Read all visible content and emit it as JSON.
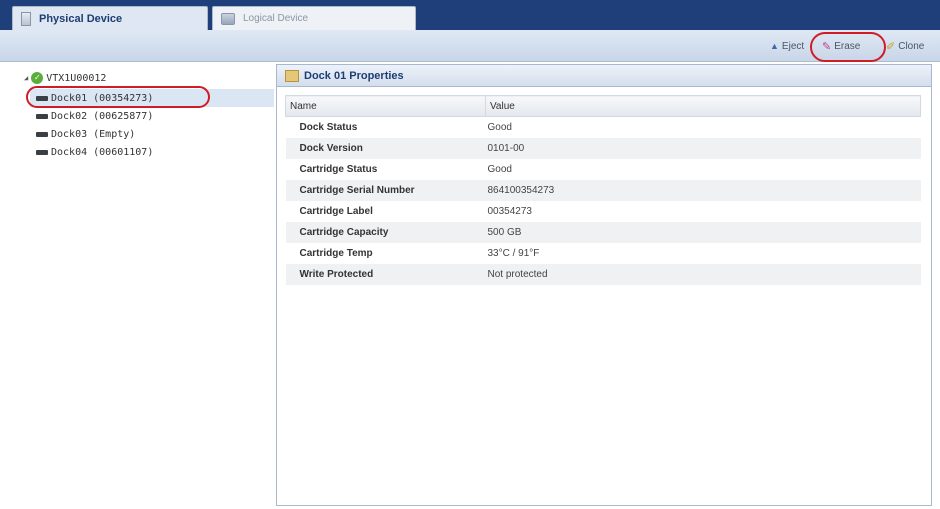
{
  "tabs": [
    {
      "label": "Physical Device",
      "active": true
    },
    {
      "label": "Logical Device",
      "active": false
    }
  ],
  "toolbar": {
    "eject_label": "Eject",
    "erase_label": "Erase",
    "clone_label": "Clone"
  },
  "tree": {
    "root_label": "VTX1U00012",
    "items": [
      {
        "label": "Dock01 (00354273)",
        "selected": true
      },
      {
        "label": "Dock02 (00625877)",
        "selected": false
      },
      {
        "label": "Dock03 (Empty)",
        "selected": false
      },
      {
        "label": "Dock04 (00601107)",
        "selected": false
      }
    ]
  },
  "properties": {
    "title": "Dock 01 Properties",
    "columns": [
      "Name",
      "Value"
    ],
    "rows": [
      {
        "name": "Dock Status",
        "value": "Good"
      },
      {
        "name": "Dock Version",
        "value": "0101-00"
      },
      {
        "name": "Cartridge Status",
        "value": "Good"
      },
      {
        "name": "Cartridge Serial Number",
        "value": "864100354273"
      },
      {
        "name": "Cartridge Label",
        "value": "00354273"
      },
      {
        "name": "Cartridge Capacity",
        "value": "500 GB"
      },
      {
        "name": "Cartridge Temp",
        "value": "33°C / 91°F"
      },
      {
        "name": "Write Protected",
        "value": "Not protected"
      }
    ]
  },
  "colors": {
    "tab_bar": "#1f3f7a",
    "highlight_ring": "#d01c28",
    "header_text": "#1d3e73"
  }
}
